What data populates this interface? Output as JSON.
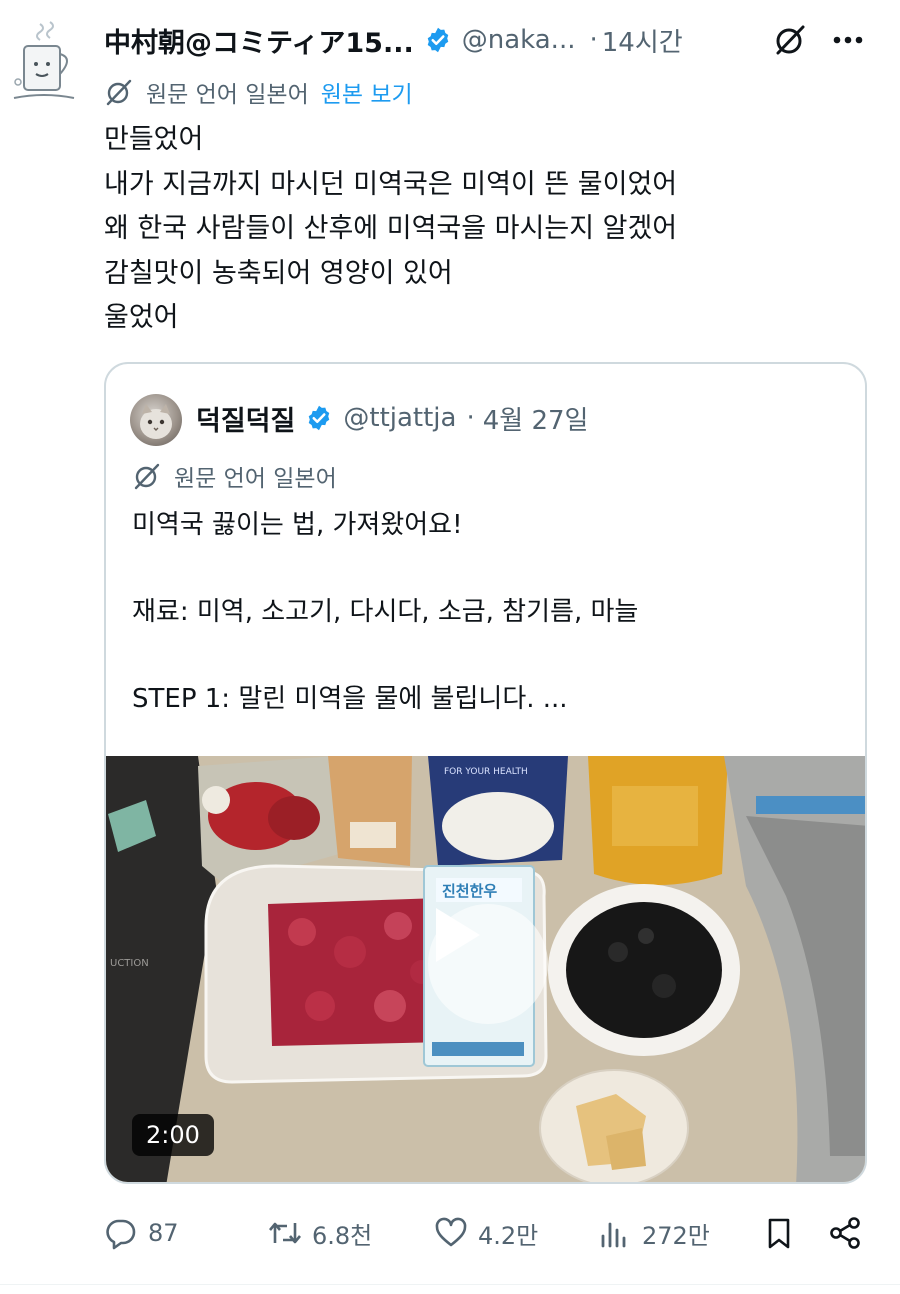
{
  "tweet": {
    "display_name": "中村朝@コミティア15...",
    "handle": "@naka...",
    "separator": "·",
    "time": "14시간",
    "translation": {
      "label": "원문 언어 일본어",
      "link": "원본 보기"
    },
    "body": "만들었어\n내가 지금까지 마시던 미역국은 미역이 뜬 물이었어\n왜 한국 사람들이 산후에 미역국을 마시는지 알겠어\n감칠맛이 농축되어 영양이 있어\n울었어"
  },
  "quote": {
    "display_name": "덕질덕질",
    "handle": "@ttjattja",
    "separator": "·",
    "date": "4월 27일",
    "translation_label": "원문 언어 일본어",
    "body": "미역국 끓이는 법, 가져왔어요!\n\n재료: 미역, 소고기, 다시다, 소금, 참기름, 마늘\n\nSTEP 1: 말린 미역을 물에 불립니다. ...",
    "media": {
      "type": "video",
      "duration": "2:00",
      "package_label": "진천한우",
      "bag_label": "FOR YOUR HEALTH",
      "sink_label": "UCTION"
    }
  },
  "actions": {
    "replies": "87",
    "reposts": "6.8천",
    "likes": "4.2만",
    "views": "272만"
  },
  "icons": {
    "verified": "verified-badge-icon",
    "grok": "grok-icon",
    "more": "more-icon",
    "translate": "translate-icon",
    "reply": "reply-icon",
    "repost": "repost-icon",
    "like": "heart-icon",
    "views": "views-icon",
    "bookmark": "bookmark-icon",
    "share": "share-icon"
  },
  "colors": {
    "link": "#1d9bf0",
    "secondary_text": "#536471",
    "primary_text": "#0f1419",
    "border": "#cfd9de"
  }
}
